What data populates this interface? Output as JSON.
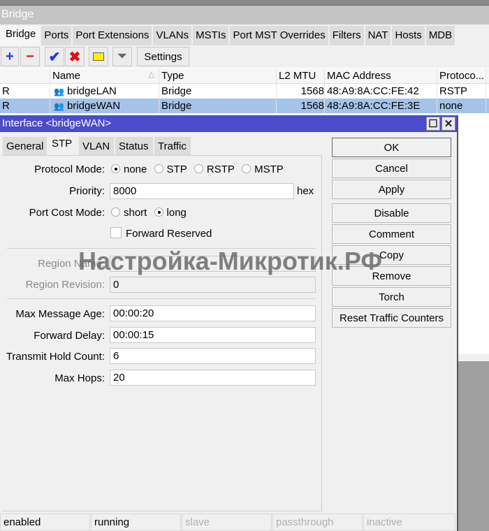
{
  "window_title": "Bridge",
  "tabs": [
    "Bridge",
    "Ports",
    "Port Extensions",
    "VLANs",
    "MSTIs",
    "Port MST Overrides",
    "Filters",
    "NAT",
    "Hosts",
    "MDB"
  ],
  "toolbar": {
    "settings_label": "Settings",
    "icons": [
      "plus-icon",
      "minus-icon",
      "check-icon",
      "cross-icon",
      "comment-icon",
      "filter-icon"
    ]
  },
  "table": {
    "columns": [
      "",
      "Name",
      "Type",
      "L2 MTU",
      "MAC Address",
      "Protoco..."
    ],
    "rows": [
      {
        "flag": "R",
        "name": "bridgeLAN",
        "type": "Bridge",
        "l2mtu": "1568",
        "mac": "48:A9:8A:CC:FE:42",
        "protocol": "RSTP",
        "selected": false
      },
      {
        "flag": "R",
        "name": "bridgeWAN",
        "type": "Bridge",
        "l2mtu": "1568",
        "mac": "48:A9:8A:CC:FE:3E",
        "protocol": "none",
        "selected": true
      }
    ]
  },
  "dialog": {
    "title": "Interface <bridgeWAN>",
    "tabs": [
      "General",
      "STP",
      "VLAN",
      "Status",
      "Traffic"
    ],
    "active_tab": "STP",
    "form": {
      "protocol_mode_label": "Protocol Mode:",
      "protocol_options": [
        "none",
        "STP",
        "RSTP",
        "MSTP"
      ],
      "protocol_selected": "none",
      "priority_label": "Priority:",
      "priority_value": "8000",
      "priority_unit": "hex",
      "port_cost_label": "Port Cost Mode:",
      "port_cost_options": [
        "short",
        "long"
      ],
      "port_cost_selected": "long",
      "forward_reserved_label": "Forward Reserved",
      "forward_reserved_checked": false,
      "region_name_label": "Region Name:",
      "region_name_value": "",
      "region_revision_label": "Region Revision:",
      "region_revision_value": "0",
      "max_message_age_label": "Max Message Age:",
      "max_message_age_value": "00:00:20",
      "forward_delay_label": "Forward Delay:",
      "forward_delay_value": "00:00:15",
      "transmit_hold_label": "Transmit Hold Count:",
      "transmit_hold_value": "6",
      "max_hops_label": "Max Hops:",
      "max_hops_value": "20"
    },
    "buttons": [
      "OK",
      "Cancel",
      "Apply",
      "Disable",
      "Comment",
      "Copy",
      "Remove",
      "Torch",
      "Reset Traffic Counters"
    ],
    "status": [
      "enabled",
      "running",
      "slave",
      "passthrough",
      "inactive"
    ]
  },
  "watermark": "Настройка-Микротик.РФ",
  "colors": {
    "titlebar": "#4b4bcb",
    "selection": "#a4c3e8"
  }
}
